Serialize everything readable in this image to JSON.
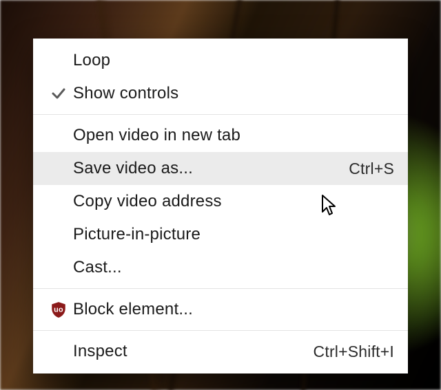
{
  "menu": {
    "group1": [
      {
        "label": "Loop",
        "checked": false
      },
      {
        "label": "Show controls",
        "checked": true
      }
    ],
    "group2": [
      {
        "label": "Open video in new tab"
      },
      {
        "label": "Save video as...",
        "shortcut": "Ctrl+S",
        "highlighted": true
      },
      {
        "label": "Copy video address"
      },
      {
        "label": "Picture-in-picture"
      },
      {
        "label": "Cast..."
      }
    ],
    "group3": [
      {
        "label": "Block element...",
        "icon": "ublock"
      }
    ],
    "group4": [
      {
        "label": "Inspect",
        "shortcut": "Ctrl+Shift+I"
      }
    ]
  }
}
